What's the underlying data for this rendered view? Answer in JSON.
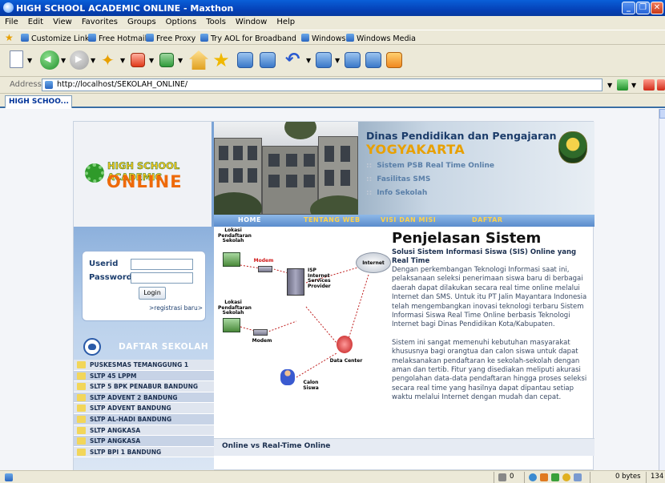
{
  "window": {
    "title": "HIGH SCHOOL ACADEMIC ONLINE - Maxthon"
  },
  "menu": [
    "File",
    "Edit",
    "View",
    "Favorites",
    "Groups",
    "Options",
    "Tools",
    "Window",
    "Help"
  ],
  "links": [
    "Customize Links",
    "Free Hotmail",
    "Free Proxy",
    "Try AOL for Broadband",
    "Windows",
    "Windows Media"
  ],
  "address": {
    "label": "Address",
    "url": "http://localhost/SEKOLAH_ONLINE/"
  },
  "tabs": [
    {
      "label": "HIGH SCHOO..."
    }
  ],
  "site": {
    "logo": {
      "line1": "HIGH SCHOOL ACADEMIC",
      "line2": "ONLINE"
    },
    "banner": {
      "agency": "Dinas Pendidikan dan Pengajaran",
      "city": "YOGYAKARTA",
      "items": [
        "Sistem PSB Real Time Online",
        "Fasilitas SMS",
        "Info Sekolah"
      ]
    },
    "nav": [
      "HOME",
      "TENTANG WEB",
      "VISI DAN MISI",
      "DAFTAR"
    ],
    "login": {
      "userid_label": "Userid",
      "password_label": "Password",
      "button": "Login",
      "register": ">registrasi baru>"
    },
    "daftar_title": "DAFTAR SEKOLAH",
    "schools": [
      "PUSKESMAS TEMANGGUNG 1",
      "SLTP 45 LPPM",
      "SLTP 5 BPK PENABUR BANDUNG",
      "SLTP ADVENT 2 BANDUNG",
      "SLTP ADVENT BANDUNG",
      "SLTP AL-HADI BANDUNG",
      "SLTP ANGKASA",
      "SLTP ANGKASA",
      "SLTP BPI 1 BANDUNG"
    ],
    "diagram": {
      "lokasi1": "Lokasi Pendaftaran Sekolah",
      "modem1": "Modem",
      "isp": "ISP Internet Services Provider",
      "internet": "Internet",
      "lokasi2": "Lokasi Pendaftaran Sekolah",
      "modem2": "Modem",
      "datacenter": "Data Center",
      "calon": "Calon Siswa"
    },
    "article": {
      "title": "Penjelasan Sistem",
      "subtitle": "Solusi Sistem Informasi Siswa (SIS) Online yang Real Time",
      "para1": "Dengan perkembangan Teknologi Informasi saat ini, pelaksanaan seleksi penerimaan siswa baru di berbagai daerah dapat dilakukan secara real time online melalui Internet dan SMS. Untuk itu PT Jalin Mayantara Indonesia telah mengembangkan inovasi teknologi terbaru Sistem Informasi Siswa Real Time Online berbasis Teknologi Internet bagi Dinas Pendidikan Kota/Kabupaten.",
      "para2": "Sistem ini sangat memenuhi kebutuhan masyarakat khususnya bagi orangtua dan calon siswa untuk dapat melaksanakan pendaftaran ke sekolah-sekolah dengan aman dan tertib. Fitur yang disediakan meliputi akurasi pengolahan data-data pendaftaran hingga proses seleksi secara real time yang hasilnya dapat dipantau setiap waktu melalui Internet dengan mudah dan cepat.",
      "footer": "Online vs Real-Time Online"
    }
  },
  "status": {
    "count": "0",
    "bytes": "0 bytes",
    "extra": "134"
  }
}
